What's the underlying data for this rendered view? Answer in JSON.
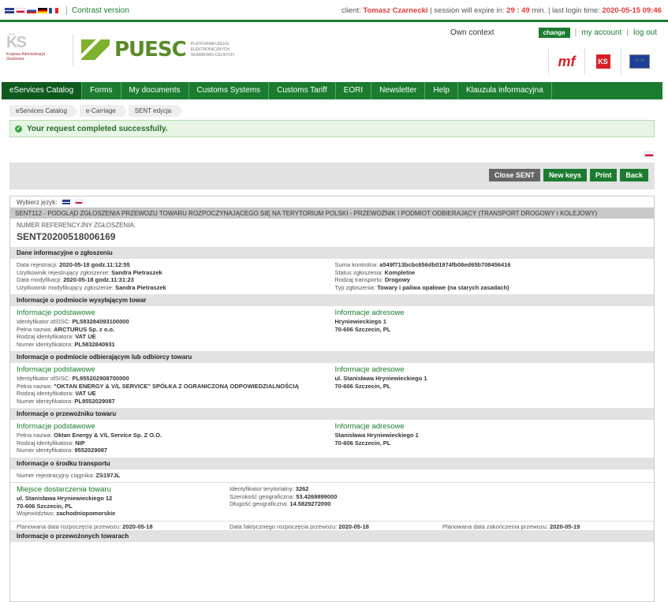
{
  "topbar": {
    "contrast": "Contrast version",
    "client_label": "client:",
    "client_name": "Tomasz Czarnecki",
    "session_label": "| session will expire in:",
    "session_time": "29 : 49",
    "session_unit": "min. | last login time:",
    "last_login": "2020-05-15 09:46"
  },
  "header": {
    "puesc_word": "PUESC",
    "puesc_sub": "PLATFORMA USŁUG ELEKTRONICZNYCH SKARBOWO-CELNYCH",
    "kas_text": "Krajowa Administracja Skarbowa",
    "own_context": "Own context",
    "change": "change",
    "my_account": "my account",
    "log_out": "log out"
  },
  "nav": [
    "eServices Catalog",
    "Forms",
    "My documents",
    "Customs Systems",
    "Customs Tariff",
    "EORI",
    "Newsletter",
    "Help",
    "Klauzula informacyjna"
  ],
  "breadcrumbs": [
    "eServices Catalog",
    "e-Carriage",
    "SENT edycja"
  ],
  "alert": "Your request completed successfully.",
  "actions": [
    "Close SENT",
    "New keys",
    "Print",
    "Back"
  ],
  "doc": {
    "lang_label": "Wybierz język:",
    "title": "SENT112 - PODGLĄD ZGŁOSZENIA PRZEWOZU TOWARU ROZPOCZYNAJĄCEGO SIĘ NA TERYTORIUM POLSKI - PRZEWOŹNIK I PODMIOT ODBIERAJĄCY (TRANSPORT DROGOWY I KOLEJOWY)",
    "ref_label": "NUMER REFERENCYJNY ZGŁOSZENIA:",
    "ref_value": "SENT20200518006169",
    "s1": {
      "head": "Dane informacyjne o zgłoszeniu",
      "l1k": "Data rejestracji:",
      "l1v": "2020-05-18 godz.11:12:55",
      "l2k": "Użytkownik rejestrujący zgłoszenie:",
      "l2v": "Sandra Pietraszek",
      "l3k": "Data modyfikacji:",
      "l3v": "2020-05-18 godz.11:31:23",
      "l4k": "Użytkownik modyfikujący zgłoszenie:",
      "l4v": "Sandra Pietraszek",
      "r1k": "Suma kontrolna:",
      "r1v": "a549f713bcbc656db01974fb08ed65b708456416",
      "r2k": "Status zgłoszenia:",
      "r2v": "Kompletne",
      "r3k": "Rodzaj transportu:",
      "r3v": "Drogowy",
      "r4k": "Typ zgłoszenia:",
      "r4v": "Towary i paliwa opałowe (na starych zasadach)"
    },
    "s2": {
      "head": "Informacje o podmiocie wysyłającym towar",
      "lt": "Informacje podstawowe",
      "l1k": "Identyfikator idSISC:",
      "l1v": "PL583284093100000",
      "l2k": "Pełna nazwa:",
      "l2v": "ARCTURUS Sp. z o.o.",
      "l3k": "Rodzaj identyfikatora:",
      "l3v": "VAT UE",
      "l4k": "Numer identyfikatora:",
      "l4v": "PL5832840931",
      "rt": "Informacje adresowe",
      "r1": "Hryniewieckiego 1",
      "r2": "70-606 Szczecin, PL"
    },
    "s3": {
      "head": "Informacje o podmiocie odbierającym lub odbiorcy towaru",
      "lt": "Informacje podstawowe",
      "l1k": "Identyfikator idSISC:",
      "l1v": "PL955202908700000",
      "l2k": "Pełna nazwa:",
      "l2v": "\"OKTAN ENERGY & V/L SERVICE\" SPÓŁKA Z OGRANICZONĄ ODPOWIEDZIALNOŚCIĄ",
      "l3k": "Rodzaj identyfikatora:",
      "l3v": "VAT UE",
      "l4k": "Numer identyfikatora:",
      "l4v": "PL9552029087",
      "rt": "Informacje adresowe",
      "r1": "ul. Stanisława Hryniewieckiego 1",
      "r2": "70-606 Szczecin, PL"
    },
    "s4": {
      "head": "Informacje o przewoźniku towaru",
      "lt": "Informacje podstawowe",
      "l1k": "Pełna nazwa:",
      "l1v": "Oktan Energy & V/L Service Sp. Z O.O.",
      "l2k": "Rodzaj identyfikatora:",
      "l2v": "NIP",
      "l3k": "Numer identyfikatora:",
      "l3v": "9552029087",
      "rt": "Informacje adresowe",
      "r1": "Stanisława Hryniewieckiego 1",
      "r2": "70-606 Szczecin, PL"
    },
    "s5": {
      "head": "Informacje o środku transportu",
      "l1k": "Numer rejestracyjny ciągnika:",
      "l1v": "ZS197JL",
      "mt": "Miejsce dostarczenia towaru",
      "m1": "ul. Stanisława Hryniewieckiego 12",
      "m2": "70-606 Szczecin, PL",
      "m3k": "Województwo:",
      "m3v": "zachodniopomorskie",
      "c1k": "Identyfikator terytorialny:",
      "c1v": "3262",
      "c2k": "Szerokość geograficzna:",
      "c2v": "53.4269899000",
      "c3k": "Długość geograficzna:",
      "c3v": "14.5829272000",
      "d1k": "Planowana data rozpoczęcia przewozu:",
      "d1v": "2020-05-18",
      "d2k": "Data faktycznego rozpoczęcia przewozu:",
      "d2v": "2020-05-18",
      "d3k": "Planowana data zakończenia przewozu:",
      "d3v": "2020-05-19"
    },
    "s6": {
      "head": "Informacje o przewożonych towarach"
    }
  }
}
